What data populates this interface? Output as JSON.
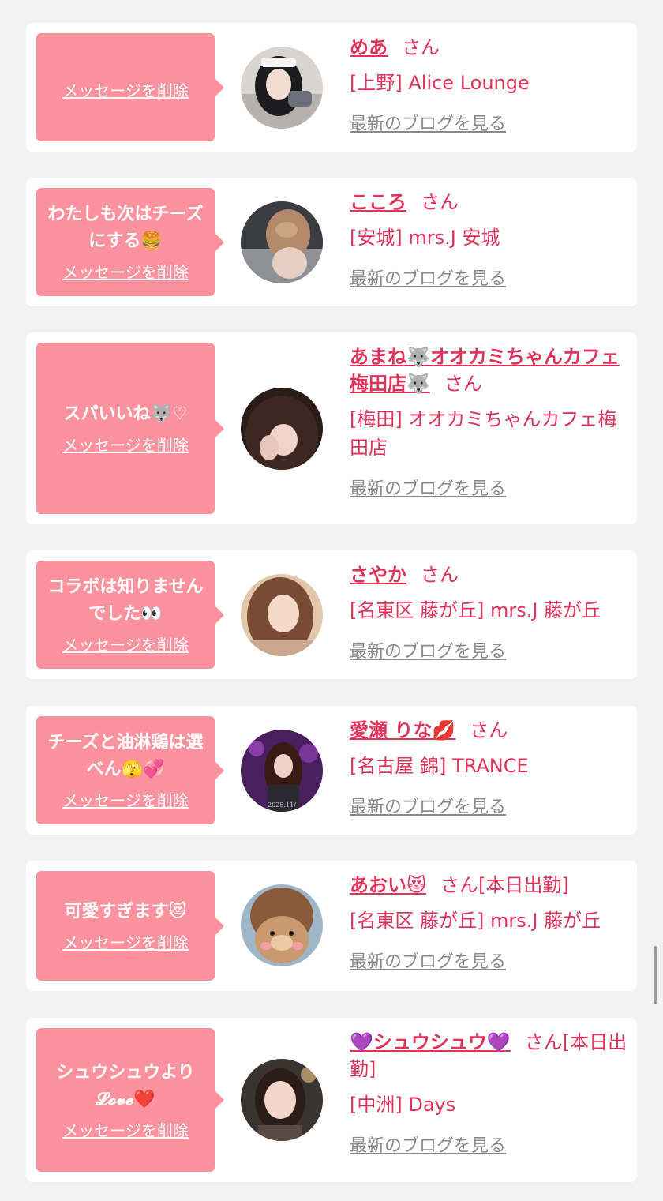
{
  "cards": [
    {
      "message": "",
      "delete_label": "メッセージを削除",
      "name": "めあ",
      "san": "さん",
      "shop": "[上野] Alice Lounge",
      "blog_label": "最新のブログを見る"
    },
    {
      "message": "わたしも次はチーズにする🍔",
      "delete_label": "メッセージを削除",
      "name": "こころ",
      "san": "さん",
      "shop": "[安城] mrs.J 安城",
      "blog_label": "最新のブログを見る"
    },
    {
      "message": "スパいいね🐺♡",
      "delete_label": "メッセージを削除",
      "name": "あまね🐺オオカミちゃんカフェ梅田店🐺",
      "san": "さん",
      "shop": "[梅田] オオカミちゃんカフェ梅田店",
      "blog_label": "最新のブログを見る"
    },
    {
      "message": "コラボは知りませんでした👀",
      "delete_label": "メッセージを削除",
      "name": "さやか",
      "san": "さん",
      "shop": "[名東区 藤が丘] mrs.J 藤が丘",
      "blog_label": "最新のブログを見る"
    },
    {
      "message": "チーズと油淋鶏は選べん🫣💞",
      "delete_label": "メッセージを削除",
      "name": "愛瀬 りな💋",
      "san": "さん",
      "shop": "[名古屋 錦] TRANCE",
      "blog_label": "最新のブログを見る"
    },
    {
      "message": "可愛すぎます😻",
      "delete_label": "メッセージを削除",
      "name": "あおい😻",
      "san": "さん[本日出勤]",
      "shop": "[名東区 藤が丘] mrs.J 藤が丘",
      "blog_label": "最新のブログを見る"
    },
    {
      "message": "シュウシュウより\n𝓛𝓸𝓿𝓮❤️",
      "delete_label": "メッセージを削除",
      "name": "💜シュウシュウ💜",
      "san": "さん[本日出勤]",
      "shop": "[中洲] Days",
      "blog_label": "最新のブログを見る"
    }
  ],
  "avatar_overlay_text": "2025.11/",
  "colors": {
    "background": "#f2f2f2",
    "card": "#ffffff",
    "bubble": "#fc929e",
    "accent_text": "#e0335a",
    "link_gray": "#8a8a8a"
  }
}
